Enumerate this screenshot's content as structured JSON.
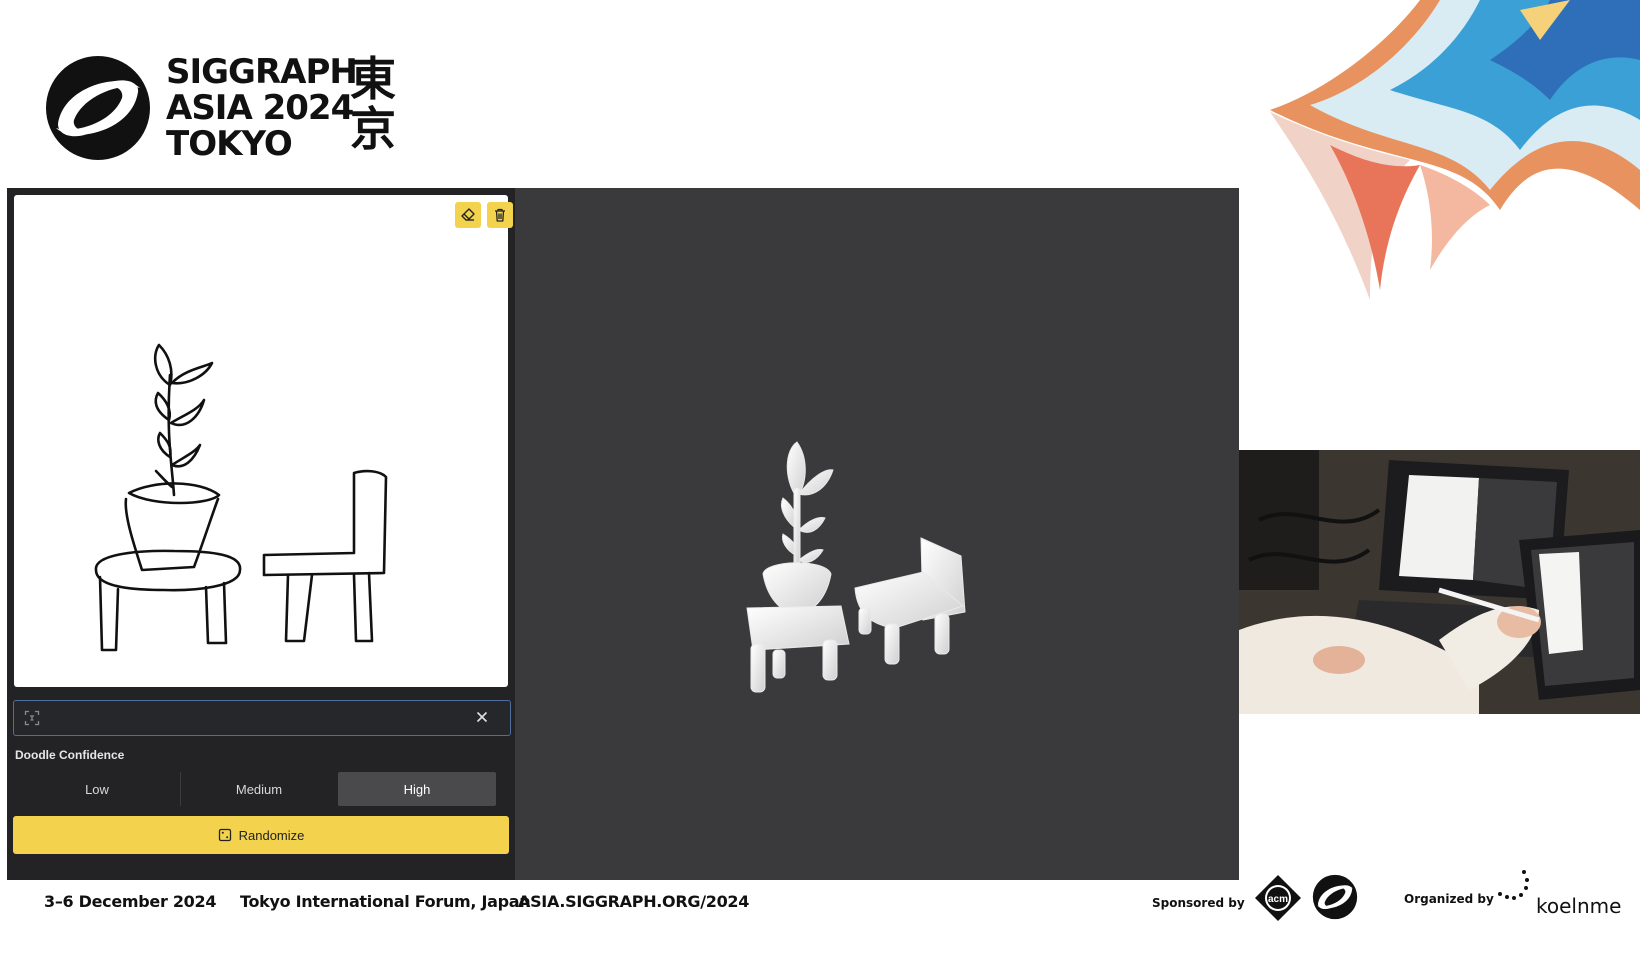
{
  "header": {
    "logo_line1": "SIGGRAPH",
    "logo_line2": "ASIA 2024",
    "logo_line3": "TOKYO",
    "logo_kanji_1": "東",
    "logo_kanji_2": "京"
  },
  "canvas": {
    "eraser_icon": "eraser-icon",
    "trash_icon": "trash-icon"
  },
  "prompt": {
    "value": "",
    "scan_icon": "scan-icon",
    "clear_icon": "close-icon"
  },
  "confidence": {
    "label": "Doodle Confidence",
    "options": [
      "Low",
      "Medium",
      "High"
    ],
    "selected": "High"
  },
  "randomize": {
    "label": "Randomize",
    "icon": "dice-icon"
  },
  "footer": {
    "dates": "3–6 December 2024",
    "venue": "Tokyo International Forum, Japan",
    "url": "ASIA.SIGGRAPH.ORG/2024",
    "sponsored_by": "Sponsored by",
    "organized_by": "Organized by",
    "organizer": "koelnme",
    "acm": "acm"
  },
  "colors": {
    "accent": "#f3d34d",
    "panel": "#232325",
    "viewport": "#3a3a3c"
  }
}
